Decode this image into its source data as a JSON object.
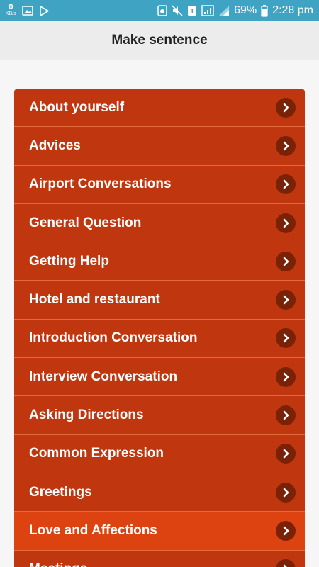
{
  "status_bar": {
    "speed_value": "0",
    "speed_unit": "KB/s",
    "sim_badge": "1",
    "battery": "69%",
    "time": "2:28 pm",
    "icons": [
      "image-icon",
      "play-store-icon",
      "storage-icon",
      "mute-icon",
      "sim-icon",
      "signal-icon",
      "battery-icon"
    ]
  },
  "header": {
    "title": "Make sentence"
  },
  "menu": {
    "items": [
      {
        "label": "About yourself"
      },
      {
        "label": "Advices"
      },
      {
        "label": "Airport Conversations"
      },
      {
        "label": "General Question"
      },
      {
        "label": "Getting Help"
      },
      {
        "label": "Hotel and restaurant"
      },
      {
        "label": "Introduction Conversation"
      },
      {
        "label": "Interview Conversation"
      },
      {
        "label": "Asking Directions"
      },
      {
        "label": "Common Expression"
      },
      {
        "label": "Greetings"
      },
      {
        "label": "Love and Affections"
      },
      {
        "label": "Meetings"
      }
    ],
    "active_index": 11,
    "colors": {
      "item_bg": "#c0360e",
      "active_bg": "#dc4310",
      "chevron_bg": "#7a2208"
    }
  },
  "colors": {
    "status_bar": "#3fa3c3",
    "app_bar": "#ececec",
    "background": "#f6f6f6"
  }
}
